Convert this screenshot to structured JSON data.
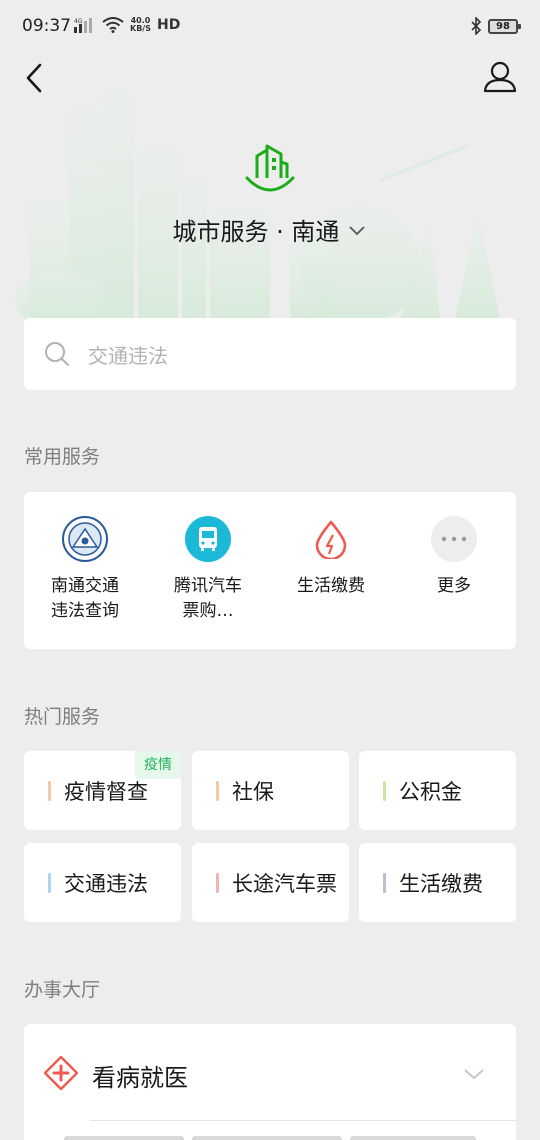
{
  "status_bar": {
    "time": "09:37",
    "network_speed_value": "40.0",
    "network_speed_unit": "KB/S",
    "hd_label": "HD",
    "battery": "98"
  },
  "header": {
    "city_title": "城市服务 · 南通"
  },
  "search": {
    "placeholder": "交通违法"
  },
  "common_services": {
    "title": "常用服务",
    "items": [
      {
        "label": "南通交通\n违法查询",
        "icon": "police-badge-icon"
      },
      {
        "label": "腾讯汽车\n票购…",
        "icon": "bus-icon"
      },
      {
        "label": "生活缴费",
        "icon": "utility-drop-icon"
      },
      {
        "label": "更多",
        "icon": "more-icon"
      }
    ]
  },
  "hot_services": {
    "title": "热门服务",
    "items": [
      {
        "label": "疫情督查",
        "bar_color": "#f4c9a3",
        "badge": "疫情"
      },
      {
        "label": "社保",
        "bar_color": "#f4c9a3"
      },
      {
        "label": "公积金",
        "bar_color": "#cbe8a1"
      },
      {
        "label": "交通违法",
        "bar_color": "#a9d6f2"
      },
      {
        "label": "长途汽车票",
        "bar_color": "#f2b4b4"
      },
      {
        "label": "生活缴费",
        "bar_color": "#b9c0d2"
      }
    ]
  },
  "hall": {
    "title": "办事大厅",
    "items": [
      {
        "label": "看病就医",
        "icon": "medical-cross-icon"
      }
    ]
  },
  "colors": {
    "accent_green": "#20b25a",
    "background": "#ededed"
  }
}
